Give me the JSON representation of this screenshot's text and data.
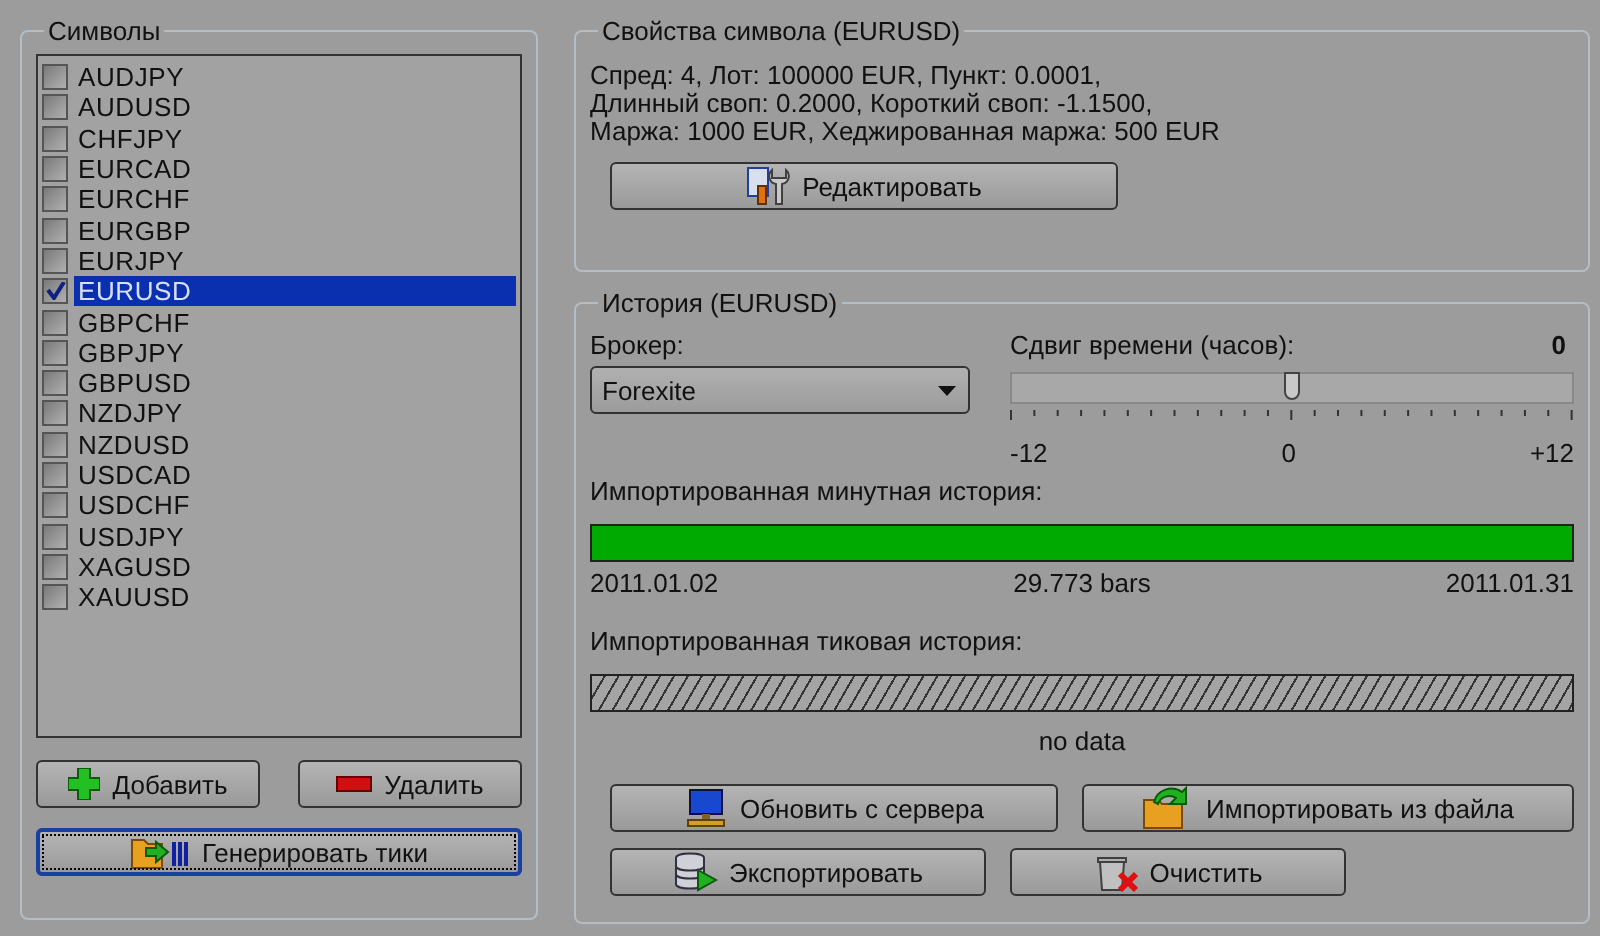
{
  "symbols": {
    "title": "Символы",
    "items": [
      {
        "label": "AUDJPY",
        "checked": false,
        "selected": false
      },
      {
        "label": "AUDUSD",
        "checked": false,
        "selected": false
      },
      {
        "label": "CHFJPY",
        "checked": false,
        "selected": false
      },
      {
        "label": "EURCAD",
        "checked": false,
        "selected": false
      },
      {
        "label": "EURCHF",
        "checked": false,
        "selected": false
      },
      {
        "label": "EURGBP",
        "checked": false,
        "selected": false
      },
      {
        "label": "EURJPY",
        "checked": false,
        "selected": false
      },
      {
        "label": "EURUSD",
        "checked": true,
        "selected": true
      },
      {
        "label": "GBPCHF",
        "checked": false,
        "selected": false
      },
      {
        "label": "GBPJPY",
        "checked": false,
        "selected": false
      },
      {
        "label": "GBPUSD",
        "checked": false,
        "selected": false
      },
      {
        "label": "NZDJPY",
        "checked": false,
        "selected": false
      },
      {
        "label": "NZDUSD",
        "checked": false,
        "selected": false
      },
      {
        "label": "USDCAD",
        "checked": false,
        "selected": false
      },
      {
        "label": "USDCHF",
        "checked": false,
        "selected": false
      },
      {
        "label": "USDJPY",
        "checked": false,
        "selected": false
      },
      {
        "label": "XAGUSD",
        "checked": false,
        "selected": false
      },
      {
        "label": "XAUUSD",
        "checked": false,
        "selected": false
      }
    ],
    "buttons": [
      {
        "label": "Добавить",
        "kind": "add"
      },
      {
        "label": "Удалить",
        "kind": "remove"
      }
    ],
    "generate_button": {
      "label": "Генерировать тики",
      "kind": "generate"
    }
  },
  "properties": {
    "title": "Свойства символа (EURUSD)",
    "lines": [
      "Спред: 4, Лот: 100000 EUR, Пункт: 0.0001,",
      "Длинный своп: 0.2000, Короткий своп: -1.1500,",
      "Маржа: 1000 EUR, Хеджированная маржа: 500 EUR"
    ],
    "edit_button": {
      "label": "Редактировать",
      "kind": "edit"
    }
  },
  "history": {
    "title": "История (EURUSD)",
    "broker_label": "Брокер:",
    "broker_value": "Forexite",
    "time_shift_label": "Сдвиг времени (часов):",
    "time_shift_value": "0",
    "slider": {
      "level": 0.5,
      "min_label": "-12",
      "mid_label": "0",
      "max_label": "+12"
    },
    "minute_history": {
      "label": "Импортированная минутная история:",
      "kind": "filled",
      "level": 1,
      "start": "2011.01.02",
      "count": "29.773 bars",
      "end": "2011.01.31"
    },
    "tick_history": {
      "label": "Импортированная тиковая история:",
      "kind": "empty",
      "status": "no data"
    },
    "buttons": [
      [
        {
          "label": "Обновить с сервера",
          "kind": "server"
        },
        {
          "label": "Импортировать из файла",
          "kind": "import"
        }
      ],
      [
        {
          "label": "Экспортировать",
          "kind": "export"
        },
        {
          "label": "Очистить",
          "kind": "clear"
        }
      ]
    ]
  }
}
